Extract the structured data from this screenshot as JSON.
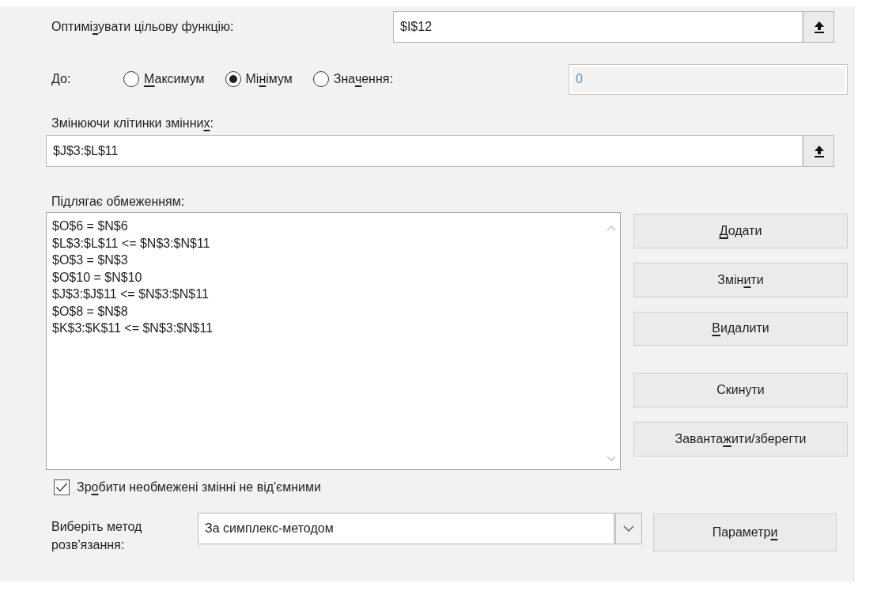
{
  "objective": {
    "label_parts": {
      "pre": "Оптимі",
      "key": "з",
      "post": "увати цільову функцію:"
    },
    "value": "$I$12"
  },
  "to": {
    "label": "До:",
    "options": [
      {
        "label_parts": {
          "key": "М",
          "post": "аксимум"
        },
        "selected": false
      },
      {
        "label_parts": {
          "pre": "Мі",
          "key": "н",
          "post": "імум"
        },
        "selected": true
      },
      {
        "label_parts": {
          "pre": "Зна",
          "key": "ч",
          "post": "ення:"
        },
        "selected": false
      }
    ],
    "value": "0",
    "value_disabled": true
  },
  "variables": {
    "label_parts": {
      "pre": "Змінюючи клітинки змінни",
      "key": "х",
      "post": ":"
    },
    "value": "$J$3:$L$11"
  },
  "constraints": {
    "label": "Підлягає обмеженням:",
    "items": [
      "$O$6 = $N$6",
      "$L$3:$L$11 <= $N$3:$N$11",
      "$O$3 = $N$3",
      "$O$10 = $N$10",
      "$J$3:$J$11 <= $N$3:$N$11",
      "$O$8 = $N$8",
      "$K$3:$K$11 <= $N$3:$N$11"
    ]
  },
  "side_buttons": [
    {
      "label_parts": {
        "key": "Д",
        "post": "одати"
      }
    },
    {
      "label_parts": {
        "pre": "Змін",
        "key": "и",
        "post": "ти"
      }
    },
    {
      "label_parts": {
        "key": "В",
        "post": "идалити"
      }
    },
    {
      "label_parts": {
        "pre": "Скинути"
      }
    },
    {
      "label_parts": {
        "pre": "Заванта",
        "key": "ж",
        "post": "ити/зберегти"
      }
    }
  ],
  "nonneg": {
    "label_parts": {
      "pre": "Зр",
      "key": "о",
      "post": "бити необмежені змінні не від'ємними"
    },
    "checked": true
  },
  "method": {
    "label": "Виберіть метод розв'язання:",
    "value": "За симплекс-методом"
  },
  "options_button": {
    "label_parts": {
      "pre": "Параметр",
      "key": "и"
    }
  }
}
